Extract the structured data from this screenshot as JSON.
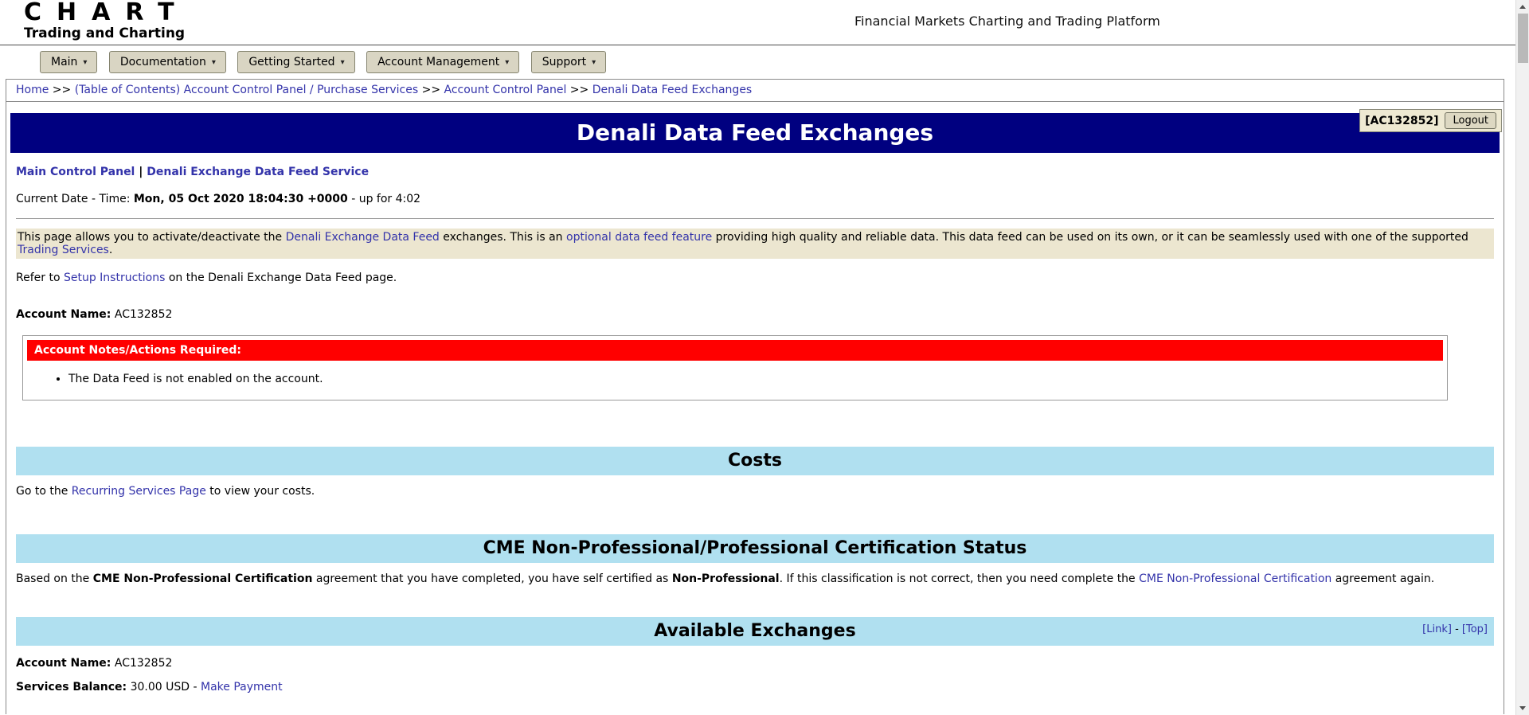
{
  "theme": {
    "banner_bg": "#000080",
    "section_header_bg": "#b0e0f0",
    "alert_bg": "#ff0000",
    "highlight_bg": "#ece6d0",
    "nav_button_bg": "#d9d5c3",
    "link_color": "#3333aa"
  },
  "icons": {
    "caret_down": "▾",
    "scroll_up": "triangle-up",
    "scroll_down": "triangle-down"
  },
  "header": {
    "logo_main": "CHART",
    "logo_sub": "Trading and Charting",
    "platform_title": "Financial Markets Charting and Trading Platform"
  },
  "nav": {
    "items": [
      {
        "label": "Main"
      },
      {
        "label": "Documentation"
      },
      {
        "label": "Getting Started"
      },
      {
        "label": "Account Management"
      },
      {
        "label": "Support"
      }
    ]
  },
  "breadcrumb": {
    "separator": " >> ",
    "items": [
      {
        "label": "Home"
      },
      {
        "label": "(Table of Contents) Account Control Panel / Purchase Services"
      },
      {
        "label": "Account Control Panel"
      },
      {
        "label": "Denali Data Feed Exchanges"
      }
    ]
  },
  "account_box": {
    "account_id": "[AC132852]",
    "logout_label": "Logout"
  },
  "banner": {
    "title": "Denali Data Feed Exchanges"
  },
  "quick_links": {
    "control_panel": "Main Control Panel",
    "separator": " | ",
    "data_feed_service": "Denali Exchange Data Feed Service"
  },
  "datetime": {
    "label": "Current Date - Time: ",
    "value": "Mon, 05 Oct 2020 18:04:30 +0000",
    "suffix": " - up for 4:02"
  },
  "intro": {
    "seg1": "This page allows you to activate/deactivate the ",
    "link1": "Denali Exchange Data Feed",
    "seg2": " exchanges. This is an ",
    "link2": "optional data feed feature",
    "seg3": " providing high quality and reliable data. This data feed can be used on its own, or it can be seamlessly used with one of the supported ",
    "link3": "Trading Services",
    "seg4": "."
  },
  "refer": {
    "seg1": "Refer to ",
    "link": "Setup Instructions",
    "seg2": " on the Denali Exchange Data Feed page."
  },
  "account": {
    "label": "Account Name:",
    "value": " AC132852"
  },
  "notes": {
    "header": "Account Notes/Actions Required:",
    "items": [
      "The Data Feed is not enabled on the account."
    ]
  },
  "costs": {
    "title": "Costs",
    "seg1": "Go to the ",
    "link": "Recurring Services Page",
    "seg2": " to view your costs."
  },
  "cme": {
    "title": "CME Non-Professional/Professional Certification Status",
    "seg1": "Based on the ",
    "bold1": "CME Non-Professional Certification",
    "seg2": " agreement that you have completed, you have self certified as ",
    "bold2": "Non-Professional",
    "seg3": ". If this classification is not correct, then you need complete the ",
    "link": "CME Non-Professional Certification",
    "seg4": " agreement again."
  },
  "available": {
    "title": "Available Exchanges",
    "link_label": "[Link]",
    "separator": " - ",
    "top_label": "[Top]"
  },
  "services": {
    "label": "Services Balance:",
    "value": " 30.00 USD - ",
    "link": "Make Payment"
  }
}
